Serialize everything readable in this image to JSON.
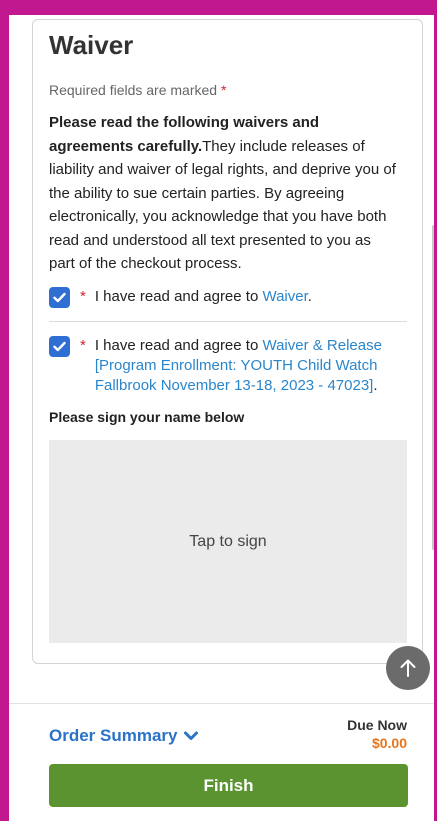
{
  "waiver": {
    "title": "Waiver",
    "required_text": "Required fields are marked",
    "required_marker": "*",
    "intro_bold": "Please read the following waivers and agreements carefully.",
    "intro_text": "They include releases of liability and waiver of legal rights, and deprive you of the ability to sue certain parties. By agreeing electronically, you acknowledge that you have both read and understood all text presented to you as part of the checkout process.",
    "agreements": [
      {
        "checked": true,
        "required_marker": "*",
        "prefix": "I have read and agree to ",
        "link_text": "Waiver",
        "suffix": "."
      },
      {
        "checked": true,
        "required_marker": "*",
        "prefix": "I have read and agree to ",
        "link_text": "Waiver & Release [Program Enrollment: YOUTH Child Watch Fallbrook November 13-18, 2023 - 47023]",
        "suffix": "."
      }
    ],
    "sign_label": "Please sign your name below",
    "sign_placeholder": "Tap to sign"
  },
  "footer": {
    "order_summary_label": "Order Summary",
    "due_now_label": "Due Now",
    "due_now_amount": "$0.00",
    "finish_label": "Finish"
  },
  "colors": {
    "frame": "#c2188f",
    "link": "#2a86cc",
    "checkbox": "#2f6fd4",
    "required": "#d2232a",
    "amount": "#e8751a",
    "finish": "#5a9330"
  },
  "icons": [
    "checkmark-icon",
    "chevron-down-icon",
    "arrow-up-icon"
  ]
}
